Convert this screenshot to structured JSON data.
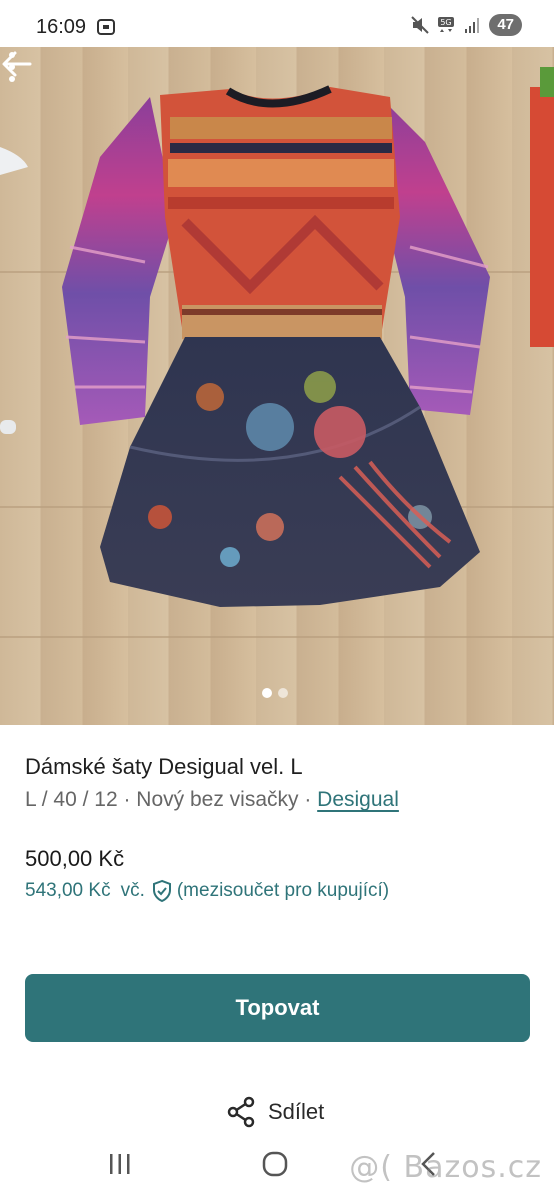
{
  "status_bar": {
    "time": "16:09",
    "battery": "47"
  },
  "photo": {
    "slide_count": 2,
    "active_slide": 1
  },
  "listing": {
    "title": "Dámské šaty Desigual vel. L",
    "meta_prefix": "L / 40 / 12 · Nový bez visačky · ",
    "brand": "Desigual",
    "price": "500,00 Kč",
    "buyer_price": "543,00 Kč",
    "buyer_price_suffix": "vč.",
    "buyer_price_note": "(mezisoučet pro kupující)"
  },
  "actions": {
    "primary_label": "Topovat",
    "share_label": "Sdílet"
  },
  "watermark": "@( Bazos.cz",
  "colors": {
    "accent": "#2f7479",
    "battery_badge": "#6e6e6e"
  }
}
